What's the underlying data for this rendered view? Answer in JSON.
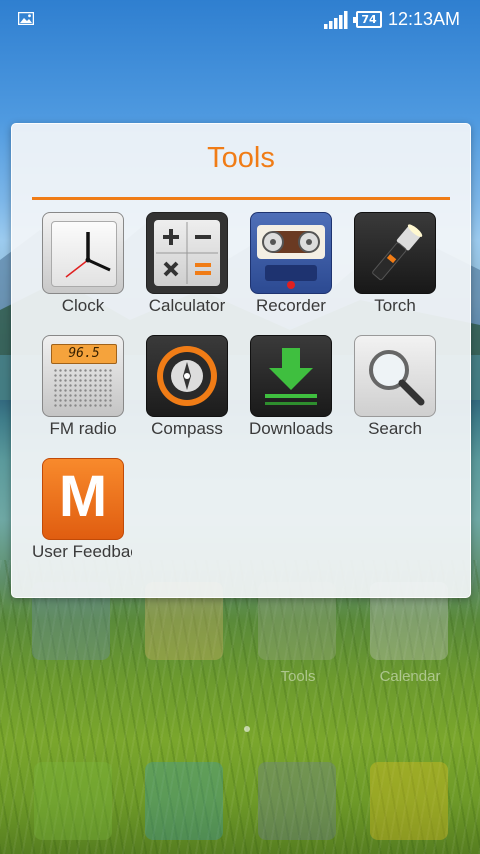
{
  "status_bar": {
    "battery": "74",
    "time": "12:13AM"
  },
  "folder": {
    "title": "Tools",
    "apps": [
      {
        "label": "Clock",
        "icon": "clock-icon"
      },
      {
        "label": "Calculator",
        "icon": "calculator-icon"
      },
      {
        "label": "Recorder",
        "icon": "recorder-icon"
      },
      {
        "label": "Torch",
        "icon": "torch-icon"
      },
      {
        "label": "FM radio",
        "icon": "fm-radio-icon",
        "display": "96.5"
      },
      {
        "label": "Compass",
        "icon": "compass-icon"
      },
      {
        "label": "Downloads",
        "icon": "downloads-icon"
      },
      {
        "label": "Search",
        "icon": "search-icon"
      },
      {
        "label": "User Feedbac",
        "icon": "user-feedback-icon",
        "glyph": "M"
      }
    ]
  },
  "background_home": {
    "faded_labels": [
      "Tools",
      "Calendar"
    ]
  },
  "colors": {
    "accent": "#f07c16"
  }
}
